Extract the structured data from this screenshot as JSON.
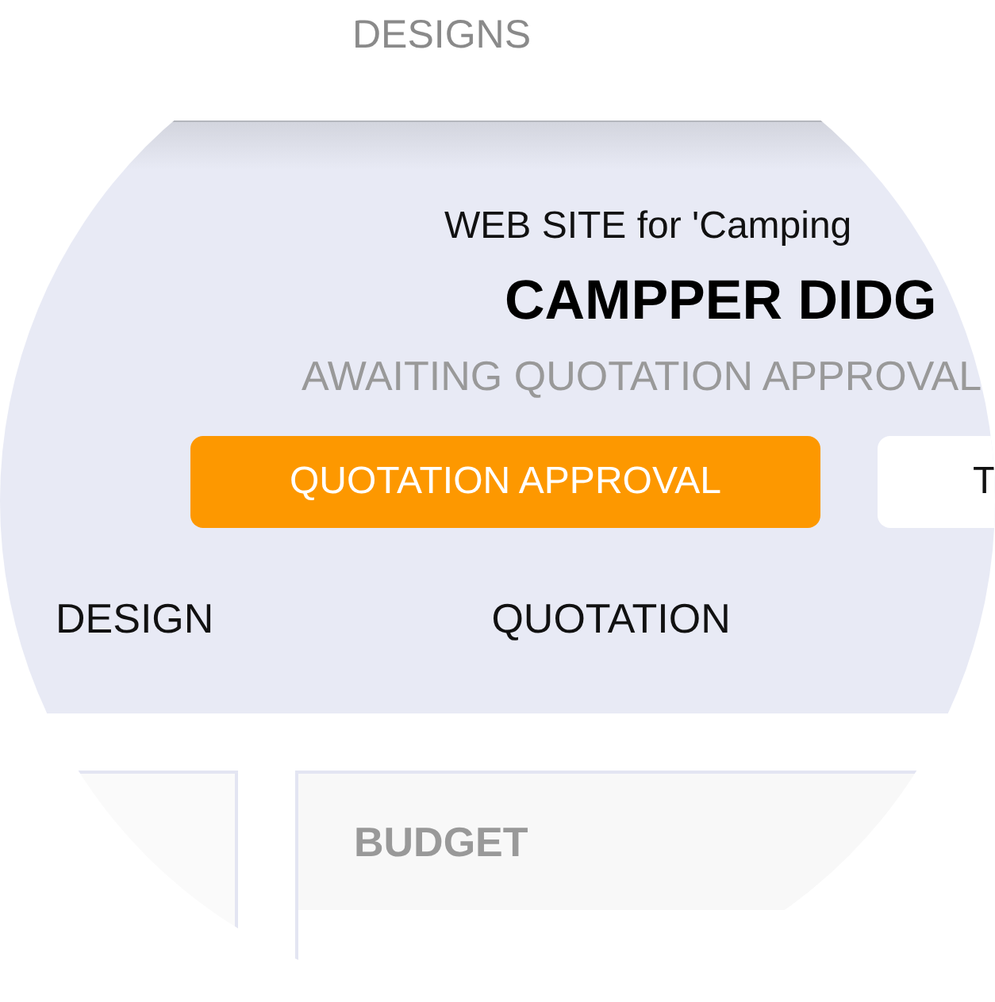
{
  "header": {
    "label": "DESIGNS"
  },
  "project": {
    "subtitle": "WEB SITE for 'Camping",
    "title": "CAMPPER DIDG",
    "status": "AWAITING QUOTATION APPROVAL"
  },
  "buttons": [
    {
      "label": "QUOTATION APPROVAL",
      "kind": "primary"
    },
    {
      "label": "T",
      "kind": "secondary"
    }
  ],
  "tabs": [
    {
      "label": "DESIGN"
    },
    {
      "label": "QUOTATION"
    }
  ],
  "cards": [
    {
      "kind": "empty"
    },
    {
      "kind": "section",
      "heading": "BUDGET"
    }
  ]
}
